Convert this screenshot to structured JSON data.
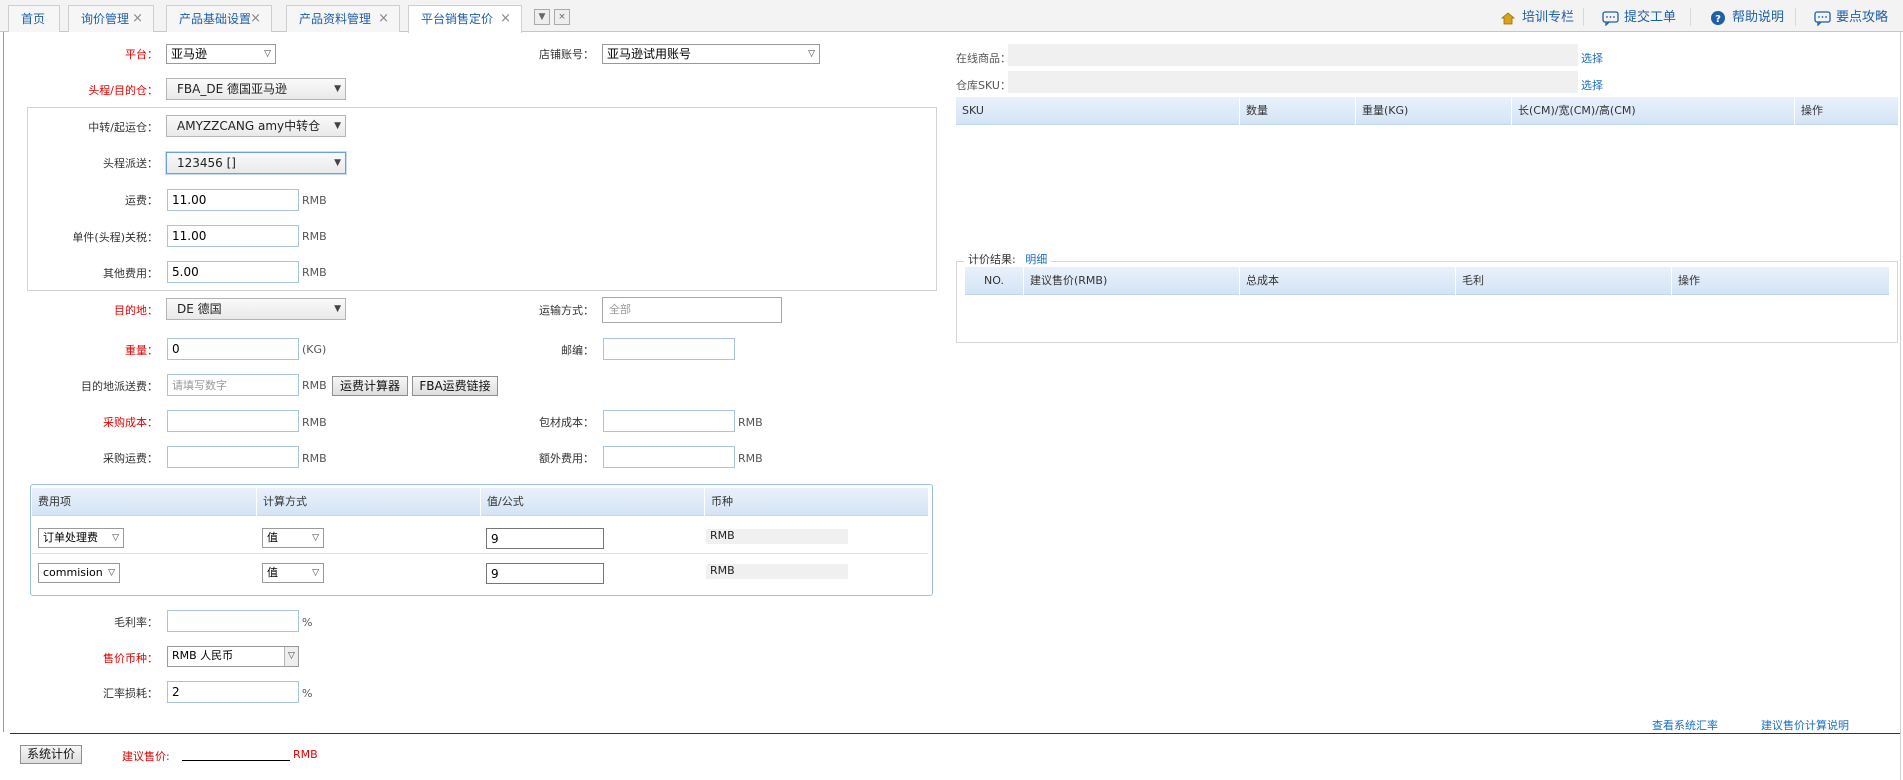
{
  "tabs": [
    {
      "label": "首页",
      "closable": false
    },
    {
      "label": "询价管理",
      "closable": true
    },
    {
      "label": "产品基础设置",
      "closable": true
    },
    {
      "label": "产品资料管理",
      "closable": true
    },
    {
      "label": "平台销售定价",
      "closable": true,
      "active": true
    }
  ],
  "close_glyph": "×",
  "tab_controls": {
    "dropdown": "▼",
    "close_all": "×"
  },
  "top_links": {
    "training": "培训专栏",
    "ticket": "提交工单",
    "help": "帮助说明",
    "tips": "要点攻略"
  },
  "form": {
    "platform": {
      "label": "平台：",
      "value": "亚马逊"
    },
    "store": {
      "label": "店铺账号：",
      "value": "亚马逊试用账号"
    },
    "first_warehouse": {
      "label": "头程/目的仓：",
      "value": "FBA_DE 德国亚马逊"
    },
    "transit_warehouse": {
      "label": "中转/起运仓：",
      "value": "AMYZZCANG amy中转仓"
    },
    "first_delivery": {
      "label": "头程派送：",
      "value": "123456 []"
    },
    "freight": {
      "label": "运费：",
      "value": "11.00",
      "unit": "RMB"
    },
    "duty": {
      "label": "单件(头程)关税：",
      "value": "11.00",
      "unit": "RMB"
    },
    "other_fee": {
      "label": "其他费用：",
      "value": "5.00",
      "unit": "RMB"
    },
    "destination": {
      "label": "目的地：",
      "value": "DE 德国"
    },
    "shipping_method": {
      "label": "运输方式：",
      "value": "全部"
    },
    "weight": {
      "label": "重量：",
      "value": "0",
      "unit": "(KG)"
    },
    "postcode": {
      "label": "邮编：",
      "value": ""
    },
    "dest_delivery_fee": {
      "label": "目的地派送费：",
      "placeholder": "请填写数字",
      "unit": "RMB"
    },
    "calc_button": "运费计算器",
    "fba_button": "FBA运费链接",
    "purchase_cost": {
      "label": "采购成本：",
      "value": "",
      "unit": "RMB"
    },
    "packing_cost": {
      "label": "包材成本：",
      "value": "",
      "unit": "RMB"
    },
    "purchase_freight": {
      "label": "采购运费：",
      "value": "",
      "unit": "RMB"
    },
    "extra_fee": {
      "label": "额外费用：",
      "value": "",
      "unit": "RMB"
    },
    "gross_margin": {
      "label": "毛利率：",
      "value": "",
      "unit": "%"
    },
    "sale_currency": {
      "label": "售价币种：",
      "value": "RMB 人民币"
    },
    "fx_loss": {
      "label": "汇率损耗：",
      "value": "2",
      "unit": "%"
    }
  },
  "fee_table": {
    "headers": [
      "费用项",
      "计算方式",
      "值/公式",
      "币种"
    ],
    "rows": [
      {
        "item": "订单处理费",
        "method": "值",
        "value": "9",
        "currency": "RMB"
      },
      {
        "item": "commision",
        "method": "值",
        "value": "9",
        "currency": "RMB"
      }
    ]
  },
  "right": {
    "online_product_label": "在线商品：",
    "warehouse_sku_label": "仓库SKU：",
    "select_link": "选择",
    "sku_headers": [
      "SKU",
      "数量",
      "重量(KG)",
      "长(CM)/宽(CM)/高(CM)",
      "操作"
    ],
    "result_title": "计价结果:",
    "result_detail_link": "明细",
    "result_headers": [
      "NO.",
      "建议售价(RMB)",
      "总成本",
      "毛利",
      "操作"
    ]
  },
  "bottom": {
    "view_summary": "查看系统汇率",
    "price_explain": "建议售价计算说明",
    "system_calc_button": "系统计价",
    "suggest_price_label": "建议售价:",
    "suggest_price_value": "",
    "suggest_price_unit": "RMB"
  },
  "colors": {
    "required_label": "#e60000",
    "link": "#1b6ec2",
    "header_bg": "#d4e4f5"
  }
}
